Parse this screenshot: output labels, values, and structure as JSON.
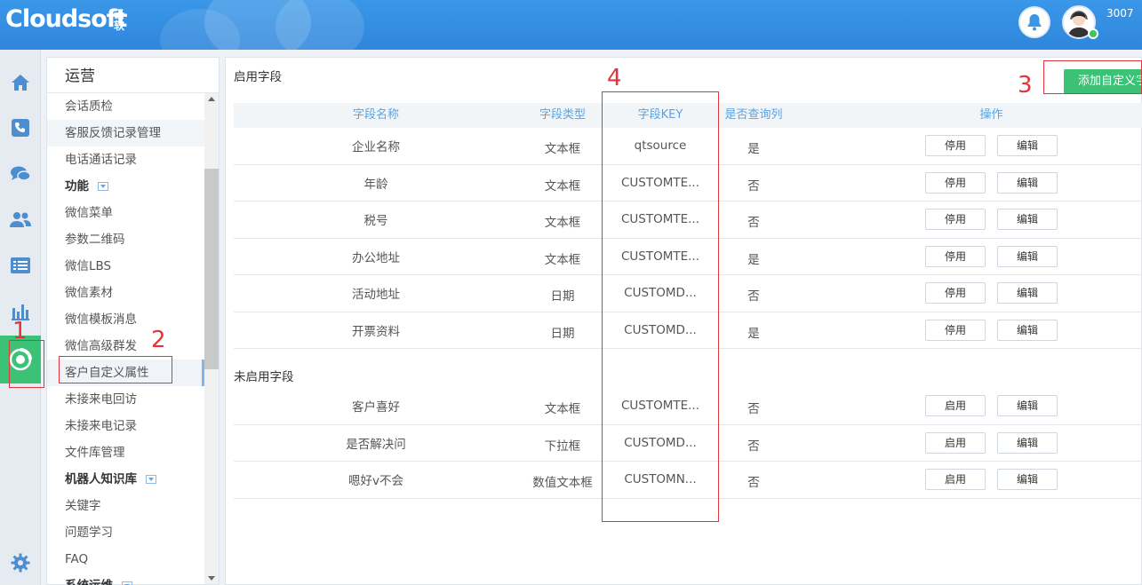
{
  "brand": {
    "logo": "Cloudsoft",
    "logo_sub": "云软"
  },
  "header": {
    "user_id": "3007"
  },
  "rail": {
    "icons": [
      "home-icon",
      "phone-icon",
      "chat-icon",
      "users-icon",
      "list-icon",
      "chart-icon",
      "operations-icon",
      "settings-icon"
    ]
  },
  "menu": {
    "title": "运营",
    "items": [
      {
        "label": "会话质检",
        "type": "item"
      },
      {
        "label": "客服反馈记录管理",
        "type": "item",
        "state": "highlight"
      },
      {
        "label": "电话通话记录",
        "type": "item"
      },
      {
        "label": "功能",
        "type": "group"
      },
      {
        "label": "微信菜单",
        "type": "item"
      },
      {
        "label": "参数二维码",
        "type": "item"
      },
      {
        "label": "微信LBS",
        "type": "item"
      },
      {
        "label": "微信素材",
        "type": "item"
      },
      {
        "label": "微信模板消息",
        "type": "item"
      },
      {
        "label": "微信高级群发",
        "type": "item"
      },
      {
        "label": "客户自定义属性",
        "type": "item",
        "state": "selected"
      },
      {
        "label": "未接来电回访",
        "type": "item"
      },
      {
        "label": "未接来电记录",
        "type": "item"
      },
      {
        "label": "文件库管理",
        "type": "item"
      },
      {
        "label": "机器人知识库",
        "type": "group"
      },
      {
        "label": "关键字",
        "type": "item"
      },
      {
        "label": "问题学习",
        "type": "item"
      },
      {
        "label": "FAQ",
        "type": "item"
      },
      {
        "label": "系统运维",
        "type": "group"
      }
    ]
  },
  "main": {
    "enabled_title": "启用字段",
    "disabled_title": "未启用字段",
    "add_button": "添加自定义字段",
    "columns": [
      "字段名称",
      "字段类型",
      "字段KEY",
      "是否查询列",
      "操作"
    ],
    "enabled_rows": [
      {
        "name": "企业名称",
        "type": "文本框",
        "key": "qtsource",
        "query": "是",
        "toggle": "停用",
        "edit": "编辑"
      },
      {
        "name": "年龄",
        "type": "文本框",
        "key": "CUSTOMTE...",
        "query": "否",
        "toggle": "停用",
        "edit": "编辑"
      },
      {
        "name": "税号",
        "type": "文本框",
        "key": "CUSTOMTE...",
        "query": "否",
        "toggle": "停用",
        "edit": "编辑"
      },
      {
        "name": "办公地址",
        "type": "文本框",
        "key": "CUSTOMTE...",
        "query": "是",
        "toggle": "停用",
        "edit": "编辑"
      },
      {
        "name": "活动地址",
        "type": "日期",
        "key": "CUSTOMD...",
        "query": "否",
        "toggle": "停用",
        "edit": "编辑"
      },
      {
        "name": "开票资料",
        "type": "日期",
        "key": "CUSTOMD...",
        "query": "是",
        "toggle": "停用",
        "edit": "编辑"
      }
    ],
    "disabled_rows": [
      {
        "name": "客户喜好",
        "type": "文本框",
        "key": "CUSTOMTE...",
        "query": "否",
        "toggle": "启用",
        "edit": "编辑"
      },
      {
        "name": "是否解决问",
        "type": "下拉框",
        "key": "CUSTOMD...",
        "query": "否",
        "toggle": "启用",
        "edit": "编辑"
      },
      {
        "name": "嗯好v不会",
        "type": "数值文本框",
        "key": "CUSTOMN...",
        "query": "否",
        "toggle": "启用",
        "edit": "编辑"
      }
    ]
  },
  "annotations": {
    "n1": "1",
    "n2": "2",
    "n3": "3",
    "n4": "4"
  },
  "colors": {
    "header": "#2f86dc",
    "accent_green": "#3cc277",
    "link_blue": "#5aa2e3",
    "annotation_red": "#e0353a"
  }
}
